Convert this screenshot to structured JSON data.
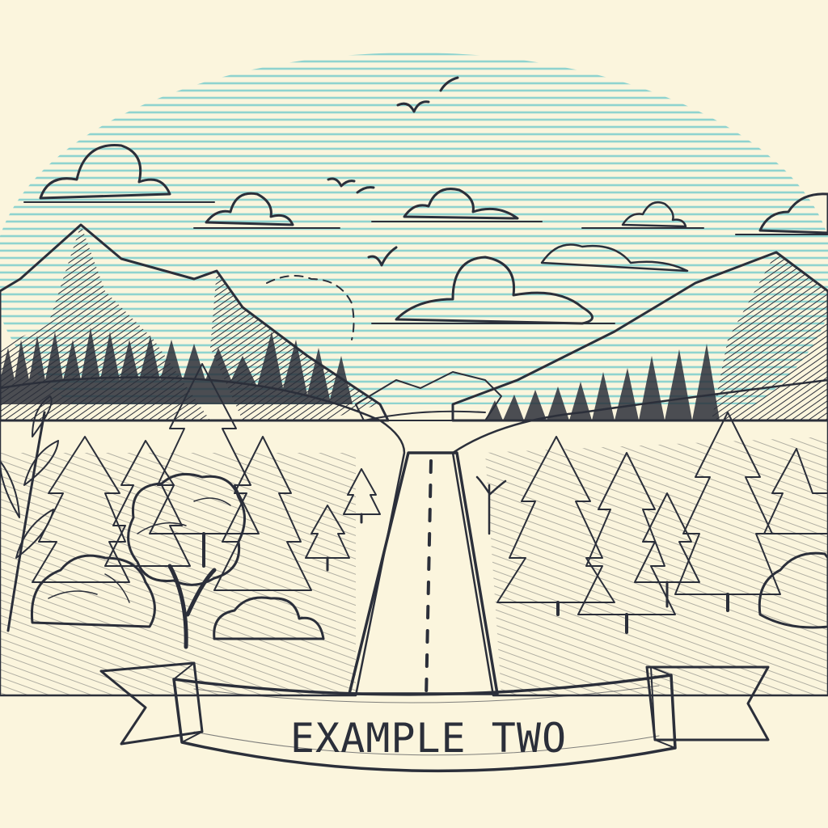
{
  "banner": {
    "text": "EXAMPLE TWO"
  },
  "colors": {
    "paper": "#fbf5dd",
    "sky_lines": "#8fd3cf",
    "ink": "#2b2f3a",
    "road": "#f7f0d6"
  },
  "scene": {
    "elements": [
      "sky",
      "clouds",
      "birds",
      "mountains",
      "pine-trees",
      "deciduous-tree",
      "bushes",
      "road",
      "banner"
    ]
  }
}
